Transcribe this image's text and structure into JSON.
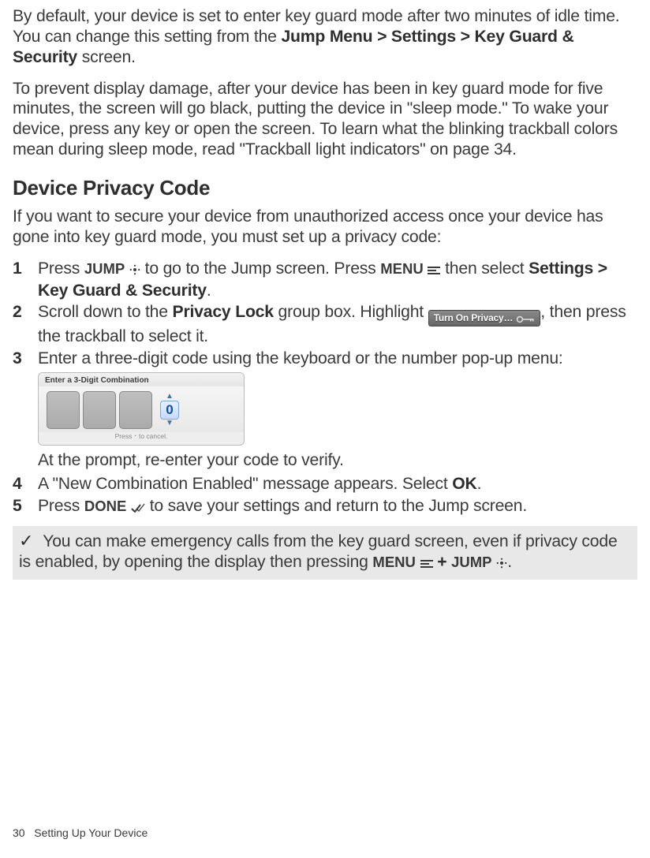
{
  "intro": {
    "p1_a": "By default, your device is set to enter key guard mode after two minutes of idle time. You can change this setting from the ",
    "p1_bold": "Jump Menu > Settings > Key Guard & Security",
    "p1_b": " screen.",
    "p2": "To prevent display damage, after your device has been in key guard mode for five minutes, the screen will go black, putting the device in \"sleep mode.\" To wake your device, press any key or open the screen. To learn what the blinking trackball colors mean during sleep mode, read \"Trackball light indicators\" on page 34."
  },
  "heading": "Device Privacy Code",
  "lead": "If you want to secure your device from unauthorized access once your device has gone into key guard mode, you must set up a privacy code:",
  "steps": {
    "s1": {
      "num": "1",
      "a": "Press ",
      "jump": "JUMP",
      "b": " to go to the Jump screen. Press ",
      "menu": "MENU",
      "c": " then select ",
      "bold": "Settings > Key Guard & Security",
      "d": "."
    },
    "s2": {
      "num": "2",
      "a": "Scroll down to the ",
      "bold": "Privacy Lock",
      "b": " group box. Highlight ",
      "btn": "Turn On Privacy…",
      "c": ", then press the trackball to select it."
    },
    "s3": {
      "num": "3",
      "a": "Enter a three-digit code using the keyboard or the number pop-up menu:"
    },
    "combobox": {
      "title": "Enter a 3-Digit Combination",
      "value": "0",
      "footer": "Press ⠂to cancel."
    },
    "caption": "At the prompt, re-enter your code to verify.",
    "s4": {
      "num": "4",
      "a": "A \"New Combination Enabled\" message appears. Select ",
      "ok": "OK",
      "b": "."
    },
    "s5": {
      "num": "5",
      "a": "Press ",
      "done": "DONE",
      "b": " to save your settings and return to the Jump screen."
    }
  },
  "note": {
    "a": "You can make emergency calls from the key guard screen, even if privacy code is enabled, by opening the display then pressing ",
    "menu": "MENU",
    "plus": " + ",
    "jump": "JUMP",
    "b": "."
  },
  "footer": {
    "page": "30",
    "section": "Setting Up Your Device"
  }
}
